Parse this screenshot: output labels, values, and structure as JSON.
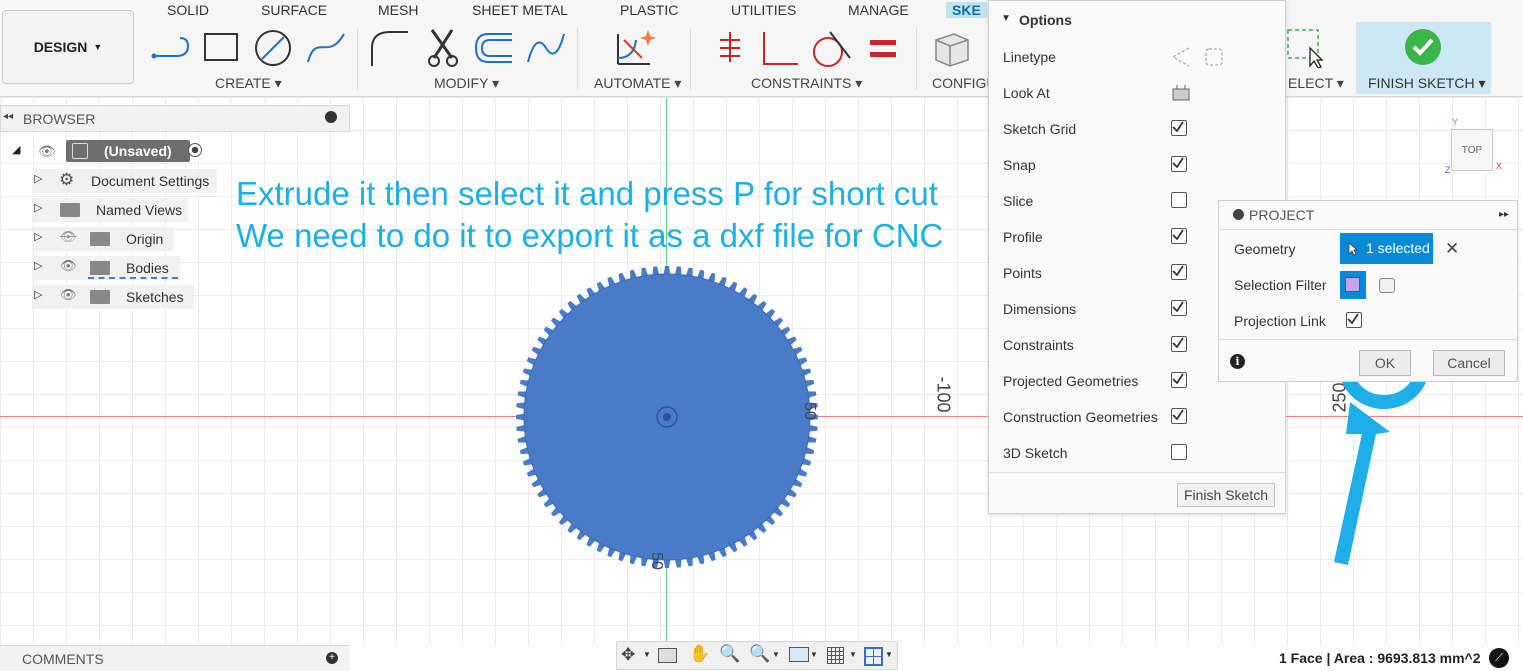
{
  "toolbar": {
    "design_label": "DESIGN",
    "tabs": [
      "SOLID",
      "SURFACE",
      "MESH",
      "SHEET METAL",
      "PLASTIC",
      "UTILITIES",
      "MANAGE",
      "SKE"
    ],
    "groups": {
      "create": "CREATE",
      "modify": "MODIFY",
      "automate": "AUTOMATE",
      "constraints": "CONSTRAINTS",
      "configure": "CONFIGU",
      "select": "ELECT",
      "finish_sketch": "FINISH SKETCH"
    }
  },
  "browser": {
    "title": "BROWSER",
    "root": "(Unsaved)",
    "items": [
      "Document Settings",
      "Named Views",
      "Origin",
      "Bodies",
      "Sketches"
    ]
  },
  "annotation": {
    "line1": "Extrude it then select it and press P for short cut",
    "line2": "We need to do it to export it as a dxf file for CNC"
  },
  "axis_labels": [
    "50",
    "-100",
    "250",
    "50"
  ],
  "options": {
    "title": "Options",
    "items": [
      {
        "label": "Linetype"
      },
      {
        "label": "Look At"
      },
      {
        "label": "Sketch Grid",
        "checked": true
      },
      {
        "label": "Snap",
        "checked": true
      },
      {
        "label": "Slice",
        "checked": false
      },
      {
        "label": "Profile",
        "checked": true
      },
      {
        "label": "Points",
        "checked": true
      },
      {
        "label": "Dimensions",
        "checked": true
      },
      {
        "label": "Constraints",
        "checked": true
      },
      {
        "label": "Projected Geometries",
        "checked": true
      },
      {
        "label": "Construction Geometries",
        "checked": true
      },
      {
        "label": "3D Sketch",
        "checked": false
      }
    ],
    "finish_button": "Finish Sketch"
  },
  "project": {
    "title": "PROJECT",
    "geometry_label": "Geometry",
    "geometry_value": "1 selected",
    "selection_filter_label": "Selection Filter",
    "projection_link_label": "Projection Link",
    "ok": "OK",
    "cancel": "Cancel"
  },
  "viewcube": {
    "face": "TOP",
    "x": "X",
    "y": "Y",
    "z": "Z"
  },
  "bottom": {
    "comments": "COMMENTS",
    "status": "1 Face | Area : 9693.813 mm^2"
  },
  "colors": {
    "accent": "#1eaee8",
    "gear": "#4a7bc8",
    "selected_bg": "#0a8ad6",
    "finish_check": "#3ab54a"
  }
}
